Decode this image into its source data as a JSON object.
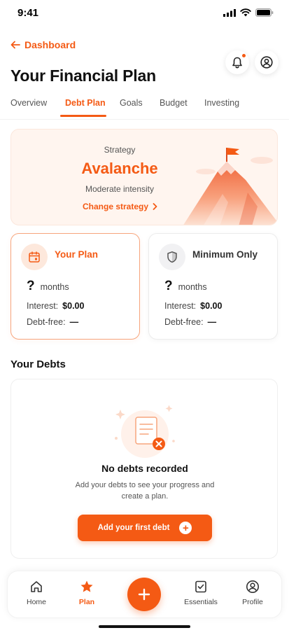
{
  "status_bar": {
    "time": "9:41"
  },
  "header": {
    "back_label": "Dashboard",
    "title": "Your Financial Plan",
    "has_notification": true
  },
  "tabs": [
    {
      "label": "Overview",
      "active": false
    },
    {
      "label": "Debt Plan",
      "active": true
    },
    {
      "label": "Goals",
      "active": false
    },
    {
      "label": "Budget",
      "active": false
    },
    {
      "label": "Investing",
      "active": false
    }
  ],
  "strategy": {
    "label": "Strategy",
    "name": "Avalanche",
    "intensity": "Moderate intensity",
    "change_label": "Change strategy"
  },
  "plans": {
    "yours": {
      "title": "Your Plan",
      "months_value": "?",
      "months_unit": "months",
      "interest_label": "Interest:",
      "interest_value": "$0.00",
      "debtfree_label": "Debt-free:",
      "debtfree_value": "—"
    },
    "minimum": {
      "title": "Minimum Only",
      "months_value": "?",
      "months_unit": "months",
      "interest_label": "Interest:",
      "interest_value": "$0.00",
      "debtfree_label": "Debt-free:",
      "debtfree_value": "—"
    }
  },
  "debts": {
    "section_title": "Your Debts",
    "empty_title": "No debts recorded",
    "empty_desc": "Add your debts to see your progress and create a plan.",
    "add_label": "Add your first debt"
  },
  "bottom_nav": {
    "items": [
      {
        "label": "Home",
        "icon": "home-icon",
        "active": false
      },
      {
        "label": "Plan",
        "icon": "star-icon",
        "active": true
      },
      {
        "label": "Essentials",
        "icon": "checklist-icon",
        "active": false
      },
      {
        "label": "Profile",
        "icon": "user-circle-icon",
        "active": false
      }
    ],
    "fab_icon": "plus-icon"
  },
  "colors": {
    "accent": "#f45a14",
    "accent_soft": "#fff5ef",
    "text": "#111111",
    "muted": "#555555"
  }
}
